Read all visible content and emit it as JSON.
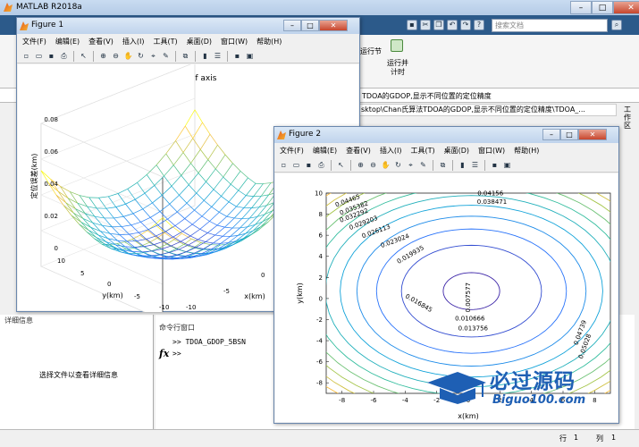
{
  "matlab": {
    "title": "MATLAB R2018a",
    "search_placeholder": "搜索文档",
    "toolstrip": {
      "run_section": "运行节",
      "run_advance": "运行并\n计时"
    },
    "address": "TDOA的GDOP,显示不同位置的定位精度",
    "path": "sktop\\Chan氏算法TDOA的GDOP,显示不同位置的定位精度\\TDOA_...",
    "right_panel": "工作区",
    "details": {
      "title": "详细信息",
      "message": "选择文件以查看详细信息"
    },
    "command_window": {
      "title": "命令行窗口",
      "line1": ">> TDOA_GDOP_5BSN",
      "line2": ">>",
      "fx": "fx"
    },
    "status": {
      "row_label": "行",
      "row": "1",
      "col_label": "列",
      "col": "1"
    },
    "window_buttons": {
      "min": "–",
      "max": "□",
      "close": "✕"
    }
  },
  "figure1": {
    "title": "Figure 1",
    "menu": [
      "文件(F)",
      "编辑(E)",
      "查看(V)",
      "插入(I)",
      "工具(T)",
      "桌面(D)",
      "窗口(W)",
      "帮助(H)"
    ],
    "plot_title": "GDOP of axis",
    "zlabel": "定位误差(km)",
    "ylabel": "y(km)",
    "xlabel": "x(km)",
    "z_ticks": [
      "0.08",
      "0.06",
      "0.04",
      "0.02",
      "0"
    ],
    "y_ticks": [
      "10",
      "5",
      "0",
      "-5",
      "-10"
    ],
    "x_ticks": [
      "-10",
      "-5",
      "0"
    ]
  },
  "figure2": {
    "title": "Figure 2",
    "menu": [
      "文件(F)",
      "编辑(E)",
      "查看(V)",
      "插入(I)",
      "工具(T)",
      "桌面(D)",
      "窗口(W)",
      "帮助(H)"
    ],
    "xlabel": "x(km)",
    "ylabel": "y(km)",
    "x_ticks": [
      "-8",
      "-6",
      "-4",
      "-2",
      "0",
      "2",
      "4",
      "6",
      "8"
    ],
    "y_ticks": [
      "10",
      "8",
      "6",
      "4",
      "2",
      "0",
      "-2",
      "-4",
      "-6",
      "-8"
    ],
    "contour_labels": [
      "0.007577",
      "0.010666",
      "0.013756",
      "0.016845",
      "0.019935",
      "0.023024",
      "0.026113",
      "0.029203",
      "0.032292",
      "0.035382",
      "0.038471",
      "0.04156",
      "0.04465",
      "0.04739",
      "0.05028"
    ]
  },
  "watermark": {
    "text": "必过源码",
    "sub": "Biguo100.com"
  },
  "chart_data": [
    {
      "type": "surface",
      "title": "GDOP of axis",
      "xlabel": "x(km)",
      "ylabel": "y(km)",
      "zlabel": "定位误差(km)",
      "xlim": [
        -10,
        10
      ],
      "ylim": [
        -10,
        10
      ],
      "zlim": [
        0,
        0.08
      ]
    },
    {
      "type": "contour",
      "xlabel": "x(km)",
      "ylabel": "y(km)",
      "xlim": [
        -9,
        9
      ],
      "ylim": [
        -9,
        10
      ],
      "levels": [
        0.007577,
        0.010666,
        0.013756,
        0.016845,
        0.019935,
        0.023024,
        0.026113,
        0.029203,
        0.032292,
        0.035382,
        0.038471,
        0.04156,
        0.04465
      ]
    }
  ]
}
